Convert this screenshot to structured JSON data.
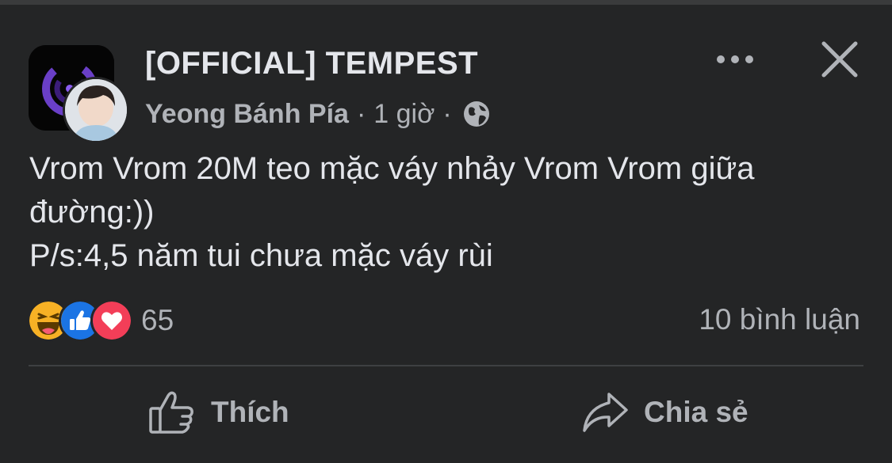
{
  "post": {
    "group_name": "[OFFICIAL] TEMPEST",
    "author": "Yeong Bánh Pía",
    "separator": "·",
    "time": "1 giờ",
    "audience_icon": "globe-icon",
    "text_lines": [
      "Vrom Vrom 20M teo mặc váy nhảy Vrom Vrom giữa",
      "đường:))",
      "P/s:4,5 năm tui chưa mặc váy rùi"
    ]
  },
  "reactions": {
    "icons": [
      "haha-icon",
      "like-reaction-icon",
      "love-icon"
    ],
    "count": "65",
    "comments": "10 bình luận"
  },
  "actions": {
    "like_label": "Thích",
    "share_label": "Chia sẻ"
  },
  "colors": {
    "background": "#242526",
    "text_primary": "#e4e6eb",
    "text_secondary": "#b0b3b8",
    "like_blue": "#1b74e4",
    "love_red": "#f33e58",
    "haha_yellow": "#f7b125",
    "group_avatar_purple": "#6a3fc7"
  }
}
